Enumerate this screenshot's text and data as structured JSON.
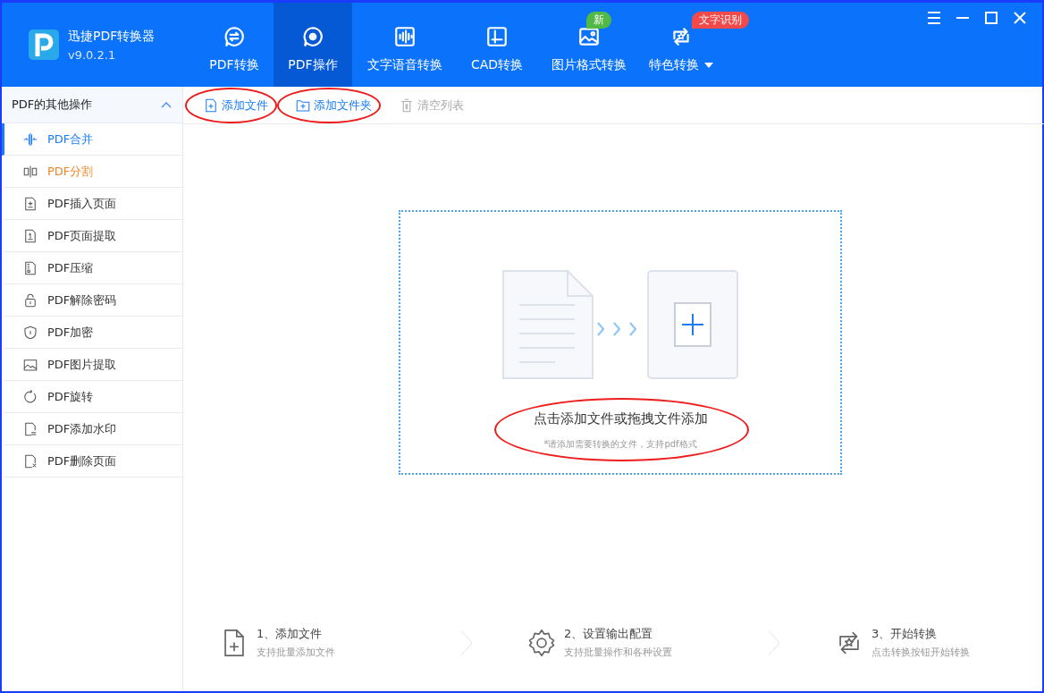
{
  "app": {
    "name": "迅捷PDF转换器",
    "version": "v9.0.2.1"
  },
  "nav": [
    {
      "label": "PDF转换",
      "selected": false
    },
    {
      "label": "PDF操作",
      "selected": true
    },
    {
      "label": "文字语音转换",
      "selected": false
    },
    {
      "label": "CAD转换",
      "selected": false
    },
    {
      "label": "图片格式转换",
      "selected": false,
      "badge": {
        "text": "新",
        "color": "#52b947"
      }
    },
    {
      "label": "特色转换",
      "selected": false,
      "dropdown": true,
      "badge": {
        "text": "文字识别",
        "color": "#f24a4a"
      }
    }
  ],
  "sidebar": {
    "title": "PDF的其他操作",
    "expanded": true,
    "items": [
      {
        "label": "PDF合并",
        "selected": true,
        "hovered": false
      },
      {
        "label": "PDF分割",
        "selected": false,
        "hovered": true
      },
      {
        "label": "PDF插入页面",
        "selected": false,
        "hovered": false
      },
      {
        "label": "PDF页面提取",
        "selected": false,
        "hovered": false
      },
      {
        "label": "PDF压缩",
        "selected": false,
        "hovered": false
      },
      {
        "label": "PDF解除密码",
        "selected": false,
        "hovered": false
      },
      {
        "label": "PDF加密",
        "selected": false,
        "hovered": false
      },
      {
        "label": "PDF图片提取",
        "selected": false,
        "hovered": false
      },
      {
        "label": "PDF旋转",
        "selected": false,
        "hovered": false
      },
      {
        "label": "PDF添加水印",
        "selected": false,
        "hovered": false
      },
      {
        "label": "PDF删除页面",
        "selected": false,
        "hovered": false
      }
    ]
  },
  "toolbar": [
    {
      "label": "添加文件",
      "disabled": false,
      "circled": true
    },
    {
      "label": "添加文件夹",
      "disabled": false,
      "circled": true
    },
    {
      "label": "清空列表",
      "disabled": true,
      "circled": false
    }
  ],
  "dropzone": {
    "title": "点击添加文件或拖拽文件添加",
    "hint": "*请添加需要转换的文件，支持pdf格式",
    "circled": true
  },
  "steps": [
    {
      "title": "1、添加文件",
      "desc": "支持批量添加文件"
    },
    {
      "title": "2、设置输出配置",
      "desc": "支持批量操作和各种设置"
    },
    {
      "title": "3、开始转换",
      "desc": "点击转换按钮开始转换"
    }
  ]
}
